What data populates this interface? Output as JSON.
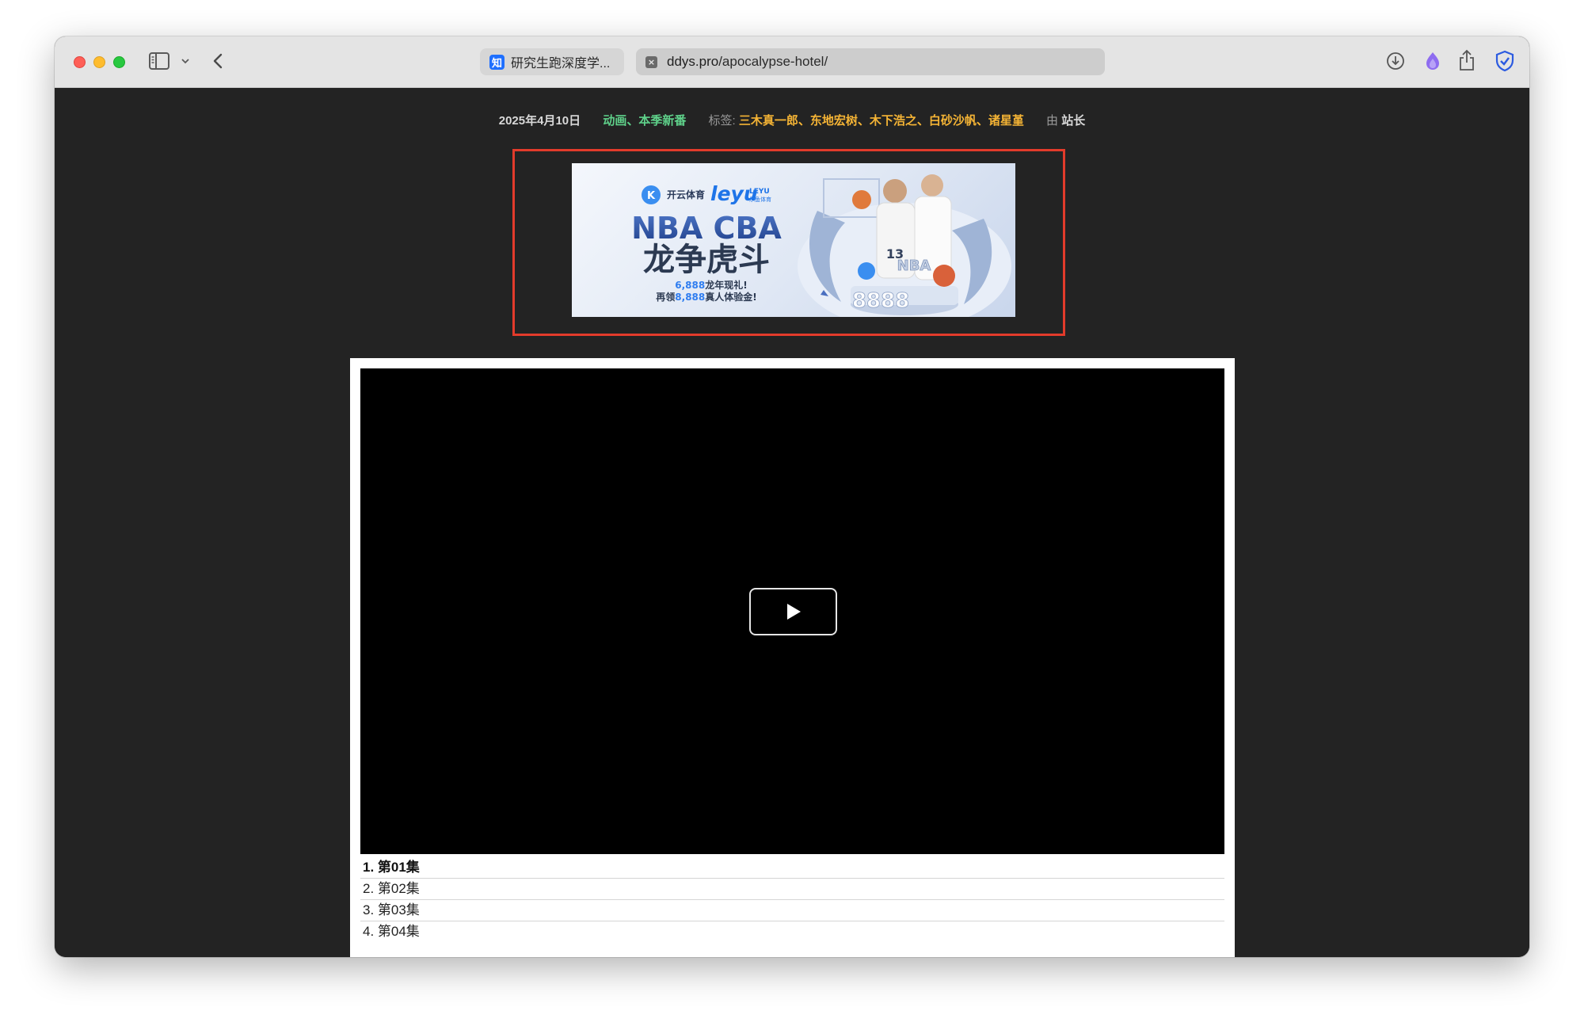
{
  "browser": {
    "tab": {
      "favicon_label": "知",
      "title": "研究生跑深度学..."
    },
    "address": {
      "favicon_label": "×",
      "domain": "ddys.pro",
      "path": "/apocalypse-hotel/"
    }
  },
  "meta": {
    "date": "2025年4月10日",
    "categories": "动画、本季新番",
    "tags_label": "标签:",
    "tags": "三木真一郎、东地宏树、木下浩之、白砂沙帆、诸星堇",
    "by_label": "由",
    "author": "站长"
  },
  "ad": {
    "brand1": "开云体育",
    "brand2": "leyu",
    "brand2_sub": "LEYU",
    "brand2_sub2": "乐鱼体育",
    "headline": "NBA CBA",
    "subheadline": "龙争虎斗",
    "line1_amount": "6,888",
    "line1_text": "龙年现礼!",
    "line2_prefix": "再领",
    "line2_amount": "8,888",
    "line2_text": "真人体验金!",
    "jersey_number": "13",
    "pedestal_text": "8888",
    "nba_text": "NBA"
  },
  "episodes": [
    {
      "label": "1. 第01集",
      "active": true
    },
    {
      "label": "2. 第02集",
      "active": false
    },
    {
      "label": "3. 第03集",
      "active": false
    },
    {
      "label": "4. 第04集",
      "active": false
    }
  ],
  "colors": {
    "page_bg": "#232323",
    "category_green": "#5fd18a",
    "tag_orange": "#f5b435",
    "ad_border": "#e23b2b"
  }
}
